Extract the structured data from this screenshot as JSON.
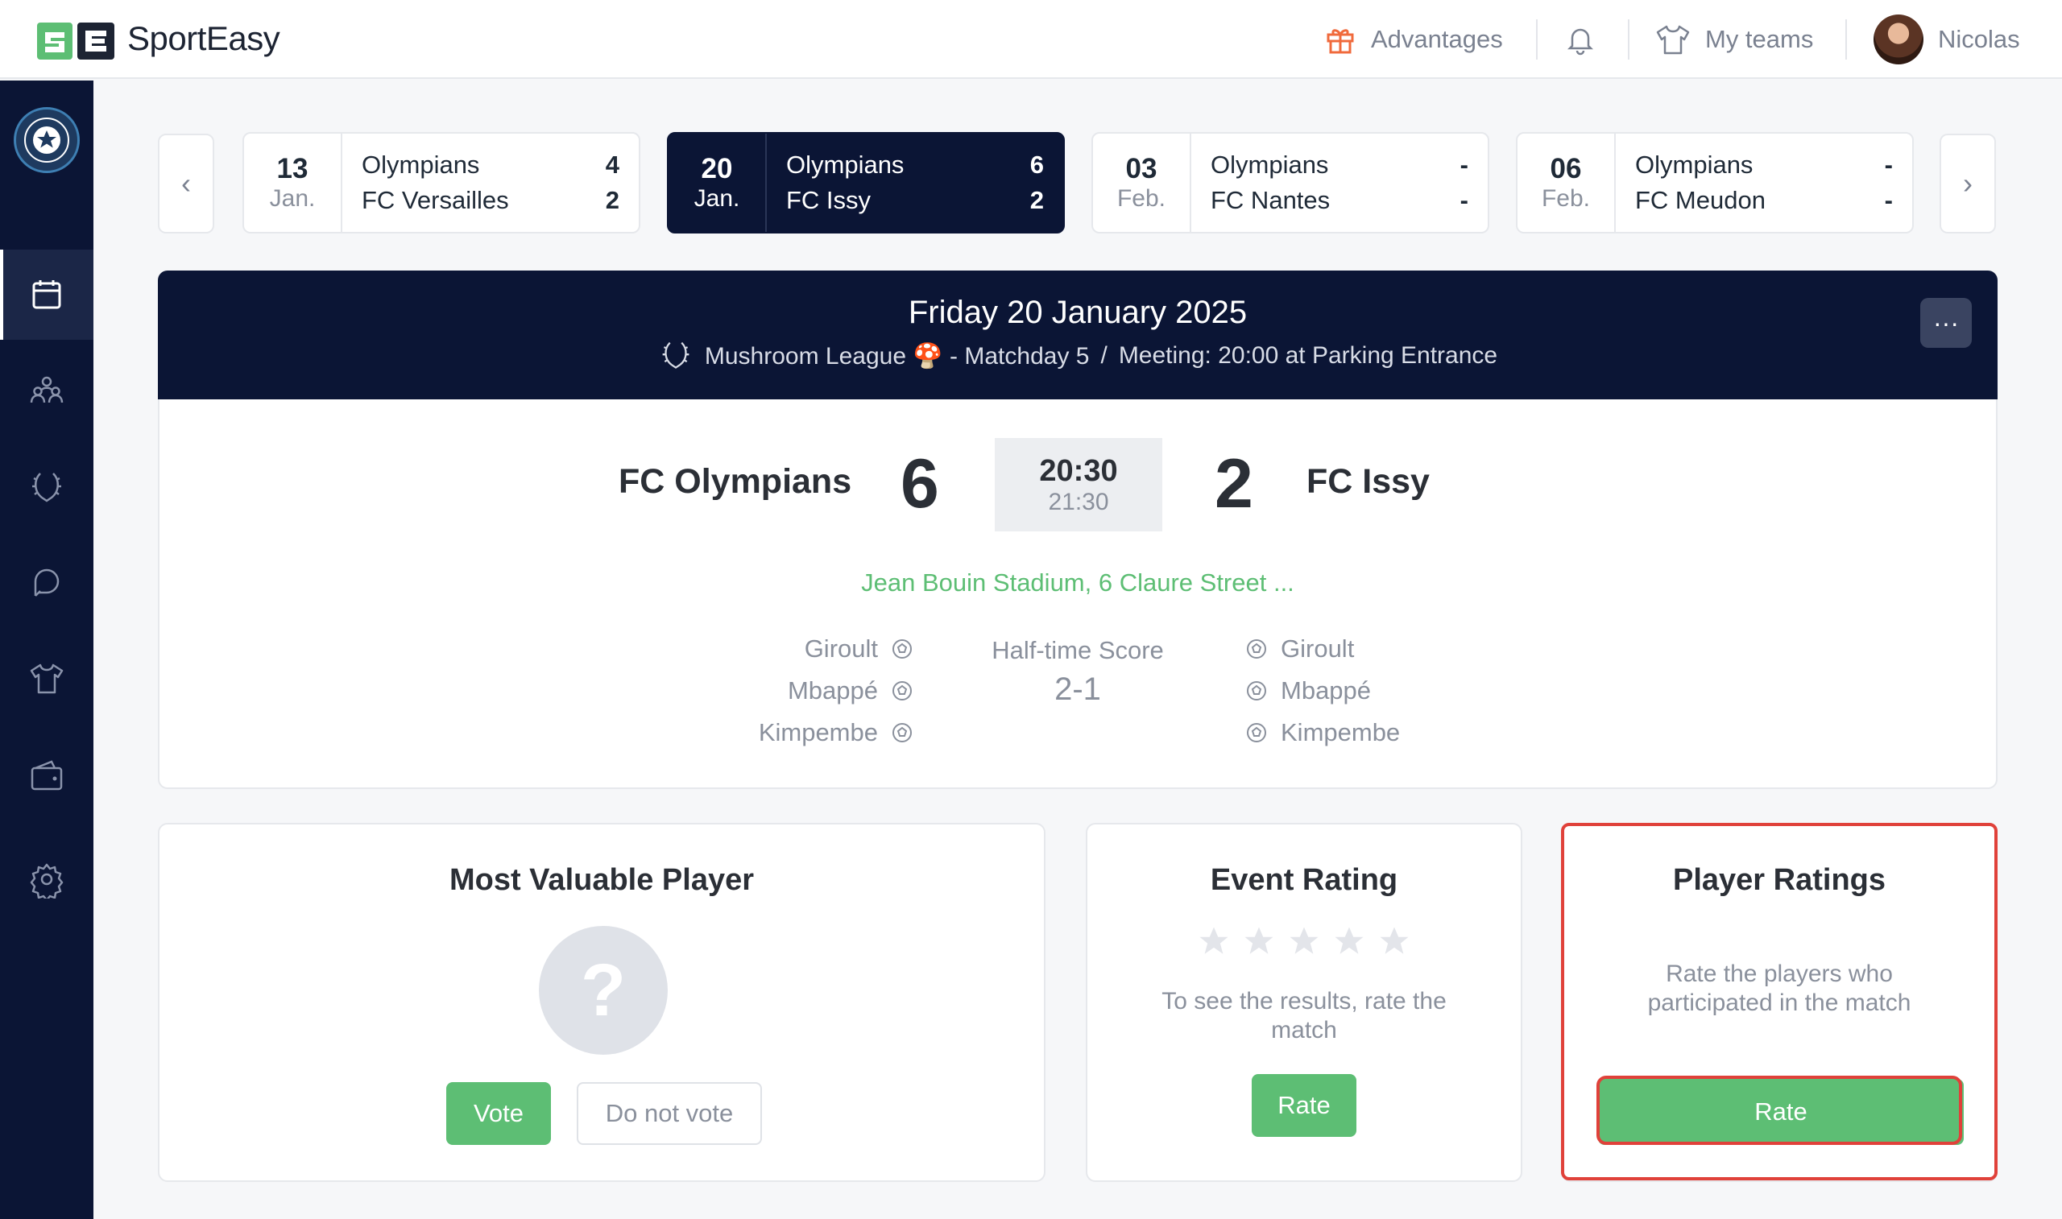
{
  "header": {
    "brand": "SportEasy",
    "advantages_label": "Advantages",
    "my_teams_label": "My teams",
    "user_name": "Nicolas"
  },
  "sidebar": {
    "items": [
      "calendar-icon",
      "members-icon",
      "competition-icon",
      "chat-icon",
      "jersey-icon",
      "wallet-icon",
      "settings-icon"
    ]
  },
  "carousel": {
    "matches": [
      {
        "day": "13",
        "month": "Jan.",
        "team1": "Olympians",
        "score1": "4",
        "team2": "FC Versailles",
        "score2": "2"
      },
      {
        "day": "20",
        "month": "Jan.",
        "team1": "Olympians",
        "score1": "6",
        "team2": "FC Issy",
        "score2": "2"
      },
      {
        "day": "03",
        "month": "Feb.",
        "team1": "Olympians",
        "score1": "-",
        "team2": "FC Nantes",
        "score2": "-"
      },
      {
        "day": "06",
        "month": "Feb.",
        "team1": "Olympians",
        "score1": "-",
        "team2": "FC Meudon",
        "score2": "-"
      }
    ]
  },
  "event": {
    "date": "Friday 20 January 2025",
    "league": "Mushroom League 🍄 - Matchday 5",
    "separator": "/",
    "meeting": "Meeting: 20:00 at Parking Entrance",
    "more_label": "···"
  },
  "score": {
    "home_team": "FC Olympians",
    "home_score": "6",
    "away_team": "FC Issy",
    "away_score": "2",
    "start_time": "20:30",
    "end_time": "21:30",
    "venue": "Jean Bouin Stadium, 6 Claure Street ...",
    "halftime_label": "Half-time Score",
    "halftime_score": "2-1",
    "home_scorers": [
      "Giroult",
      "Mbappé",
      "Kimpembe"
    ],
    "away_scorers": [
      "Giroult",
      "Mbappé",
      "Kimpembe"
    ]
  },
  "mvp": {
    "title": "Most Valuable Player",
    "placeholder": "?",
    "vote_label": "Vote",
    "no_vote_label": "Do not vote"
  },
  "event_rating": {
    "title": "Event Rating",
    "stars": 5,
    "rating": 0,
    "text": "To see the results, rate the match",
    "rate_label": "Rate"
  },
  "player_ratings": {
    "title": "Player Ratings",
    "text": "Rate the players who participated in the match",
    "rate_label": "Rate"
  },
  "colors": {
    "navy": "#0b1535",
    "green": "#5dbe74",
    "highlight": "#e0413a"
  }
}
